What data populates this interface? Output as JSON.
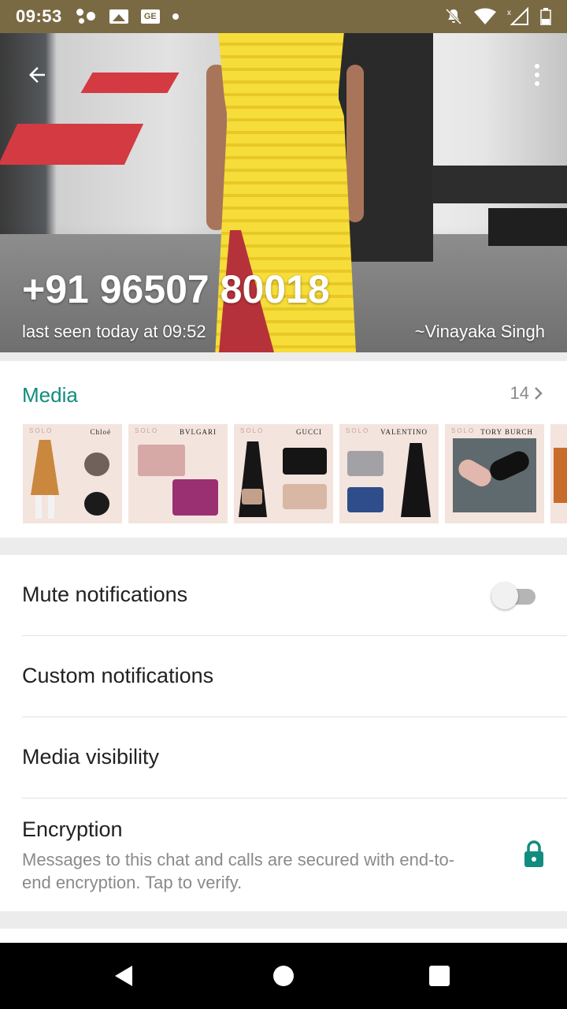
{
  "status_bar": {
    "time": "09:53",
    "icons": [
      "assistant-dots-icon",
      "photo-notification-icon",
      "gmail-notification-icon",
      "dot-icon",
      "mute-bell-icon",
      "wifi-icon",
      "signal-icon",
      "battery-icon"
    ],
    "gmail_glyph": "GE"
  },
  "header": {
    "contact_number": "+91 96507 80018",
    "last_seen": "last seen today at 09:52",
    "push_name": "~Vinayaka Singh",
    "back_icon": "arrow-back-icon",
    "menu_icon": "more-vert-icon"
  },
  "media": {
    "title": "Media",
    "count": "14",
    "thumbs": [
      {
        "brand": "Chloé",
        "label": "SOLO"
      },
      {
        "brand": "BVLGARI",
        "label": "SOLO"
      },
      {
        "brand": "GUCCI",
        "label": "SOLO"
      },
      {
        "brand": "VALENTINO",
        "label": "SOLO"
      },
      {
        "brand": "TORY BURCH",
        "label": "SOLO"
      }
    ]
  },
  "settings": {
    "mute": {
      "label": "Mute notifications",
      "enabled": false
    },
    "custom": {
      "label": "Custom notifications"
    },
    "visibility": {
      "label": "Media visibility"
    },
    "encryption": {
      "label": "Encryption",
      "subtitle": "Messages to this chat and calls are secured with end-to-end encryption. Tap to verify."
    }
  },
  "colors": {
    "accent": "#128c7e",
    "status_bar": "#7a6a44"
  },
  "nav": {
    "back": "nav-back-icon",
    "home": "nav-home-icon",
    "recents": "nav-recents-icon"
  }
}
